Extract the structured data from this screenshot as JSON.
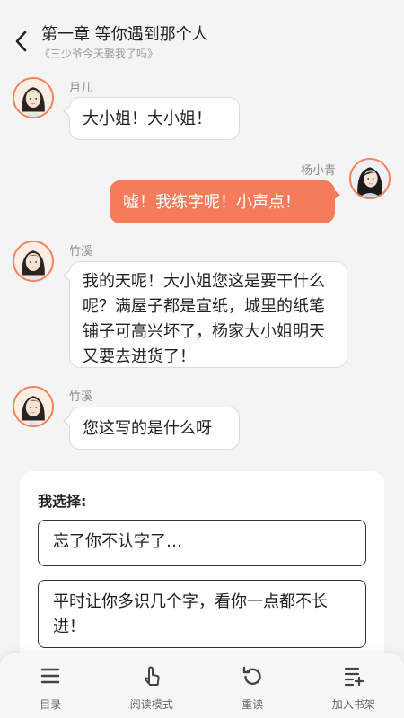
{
  "header": {
    "title": "第一章 等你遇到那个人",
    "subtitle": "《三少爷今天娶我了吗》"
  },
  "messages": [
    {
      "side": "left",
      "name": "月儿",
      "text": "大小姐！大小姐！"
    },
    {
      "side": "right",
      "name": "杨小青",
      "text": "嘘！我练字呢！小声点！"
    },
    {
      "side": "left",
      "name": "竹溪",
      "text": "我的天呢！大小姐您这是要干什么呢？满屋子都是宣纸，城里的纸笔铺子可高兴坏了，杨家大小姐明天又要去进货了！"
    },
    {
      "side": "left",
      "name": "竹溪",
      "text": "您这写的是什么呀"
    }
  ],
  "choices": {
    "label": "我选择:",
    "options": [
      "忘了你不认字了…",
      "平时让你多识几个字，看你一点都不长进！"
    ]
  },
  "bottom_nav": [
    {
      "icon": "menu-list-icon",
      "label": "目录"
    },
    {
      "icon": "tap-hand-icon",
      "label": "阅读模式"
    },
    {
      "icon": "replay-icon",
      "label": "重读"
    },
    {
      "icon": "add-bookshelf-icon",
      "label": "加入书架"
    }
  ],
  "colors": {
    "accent": "#f47c5b",
    "avatar_border": "#f2835f",
    "background": "#f4f4f4"
  }
}
